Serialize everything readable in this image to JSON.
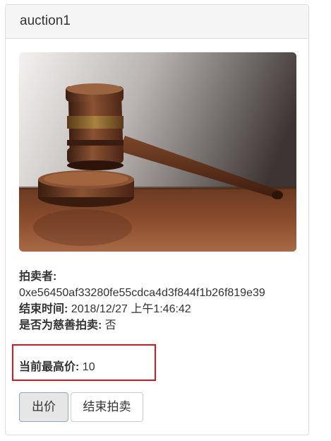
{
  "panel": {
    "title": "auction1"
  },
  "image": {
    "icon": "gavel-image"
  },
  "details": {
    "seller_label": "拍卖者:",
    "seller_value": "0xe56450af33280fe55cdca4d3f844f1b26f819e39",
    "end_time_label": "结束时间:",
    "end_time_value": "2018/12/27 上午1:46:42",
    "charity_label": "是否为慈善拍卖:",
    "charity_value": "否",
    "highest_label": "当前最高价:",
    "highest_value": "10"
  },
  "buttons": {
    "bid_label": "出价",
    "end_label": "结束拍卖"
  },
  "colors": {
    "highlight_border": "#e0141c",
    "panel_heading_bg": "#f5f5f5"
  }
}
